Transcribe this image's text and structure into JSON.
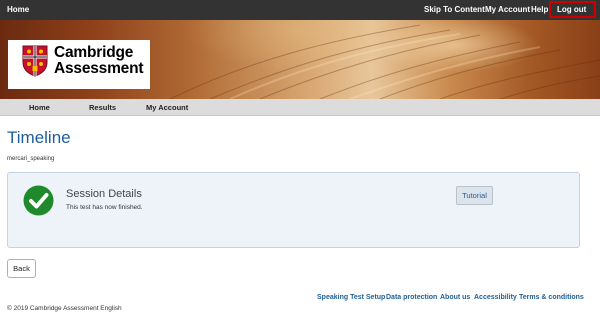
{
  "topbar": {
    "home": "Home",
    "skip": "Skip To Content",
    "account": "My Account",
    "help": "Help",
    "logout": "Log out"
  },
  "logo": {
    "line1": "Cambridge",
    "line2": "Assessment"
  },
  "nav": {
    "items": [
      "Home",
      "Results",
      "My Account"
    ]
  },
  "page": {
    "title": "Timeline",
    "username": "mercari_speaking"
  },
  "session": {
    "title": "Session Details",
    "status": "This test has now finished.",
    "tutorial_label": "Tutorial"
  },
  "actions": {
    "back_label": "Back"
  },
  "footer": {
    "links": [
      "Speaking Test Setup",
      "Data protection",
      "About us",
      "Accessibility",
      "Terms & conditions"
    ],
    "copyright": "© 2019 Cambridge Assessment English"
  },
  "colors": {
    "topbar": "#333333",
    "accent": "#1f5f96",
    "check_green": "#1f8a2b",
    "logout_outline": "#d10000",
    "panel_bg": "#eef3fa"
  }
}
